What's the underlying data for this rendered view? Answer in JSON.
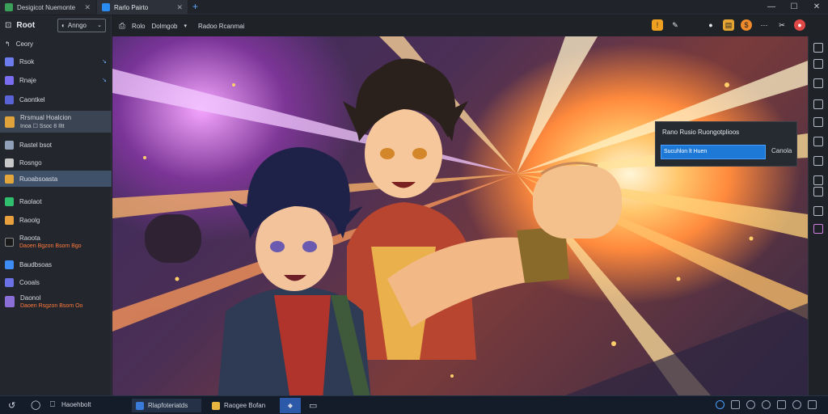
{
  "tabs": [
    {
      "label": "Desigicot Nuemonte",
      "active": false
    },
    {
      "label": "Rarlo  Pairto",
      "active": true
    }
  ],
  "sidebar": {
    "title": "Root",
    "dropdown": "Anngo",
    "back_label": "Ceory",
    "items": [
      {
        "label": "Rsok",
        "meta": "↘",
        "color": "#6d7df0"
      },
      {
        "label": "Rnaje",
        "meta": "↘",
        "color": "#7b6df0"
      },
      {
        "label": "Caontkel",
        "meta": "",
        "color": "#5a63d6"
      },
      {
        "label": "Rrsmual Hoalcion",
        "sub": "Inoa  ☐  Ssoc  8  Iltt",
        "color": "#e0a23a"
      },
      {
        "label": "Rastel bsot",
        "meta": "",
        "color": "#8fa0b8"
      },
      {
        "label": "Rosngo",
        "meta": "",
        "color": "#c8c8c8"
      },
      {
        "label": "Ruoabsoasta",
        "meta": "",
        "color": "#e2a63a"
      },
      {
        "label": "Raolaot",
        "meta": "",
        "color": "#2fbf6d"
      },
      {
        "label": "Raoolg",
        "meta": "",
        "color": "#e8a03e"
      },
      {
        "label": "Raoota",
        "warn": "Daoen  Bgzon  Bsom  Bgo",
        "color": "#1a1a1a"
      },
      {
        "label": "Baudbsoas",
        "color": "#3d8df5"
      },
      {
        "label": "Cooals",
        "color": "#6c72e6"
      },
      {
        "label": "Daonol",
        "warn": "Daoen  Rsgzon  Bsom  Oo",
        "color": "#8b6fd6"
      }
    ]
  },
  "toolbar": {
    "path_root": "Rolo",
    "path_sub": "Dolmgob",
    "path_leaf": "Radoo Rcanmai"
  },
  "modal": {
    "label": "Rano  Rusio  Ruongotplioos",
    "input": "Sucuhlon  lt  Huen",
    "cancel": "Canola"
  },
  "taskbar": {
    "items": [
      {
        "label": "Rlapfoteriatds"
      },
      {
        "label": "Raogee  Bofan"
      }
    ],
    "file_label": "Haoehbolt"
  }
}
